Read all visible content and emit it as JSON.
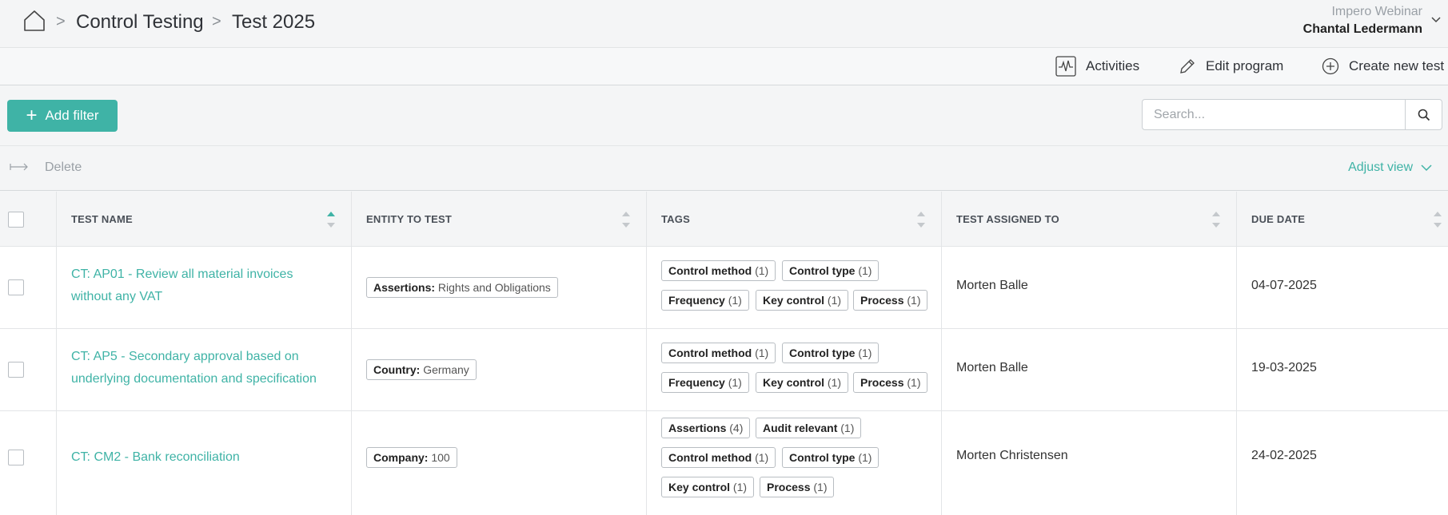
{
  "breadcrumb": {
    "items": [
      "Control Testing",
      "Test 2025"
    ],
    "separator": ">"
  },
  "user": {
    "company": "Impero Webinar",
    "name": "Chantal Ledermann"
  },
  "actions": {
    "activities": "Activities",
    "edit_program": "Edit program",
    "create_test": "Create new test"
  },
  "filter": {
    "add_label": "Add filter",
    "add_icon": "+",
    "search_placeholder": "Search..."
  },
  "bulk": {
    "delete": "Delete",
    "adjust_view": "Adjust view"
  },
  "columns": [
    "TEST NAME",
    "ENTITY TO TEST",
    "TAGS",
    "TEST ASSIGNED TO",
    "DUE DATE"
  ],
  "rows": [
    {
      "name_line1": "CT: AP01 - Review all material invoices",
      "name_line2": "without any VAT",
      "entity_key": "Assertions:",
      "entity_val": " Rights and Obligations",
      "tags": [
        {
          "k": "Control method",
          "c": " (1)"
        },
        {
          "k": "Control type",
          "c": " (1)"
        },
        {
          "k": "Frequency",
          "c": " (1)"
        },
        {
          "k": "Key control",
          "c": " (1)"
        },
        {
          "k": "Process",
          "c": " (1)"
        }
      ],
      "assigned": "Morten Balle",
      "due": "04-07-2025"
    },
    {
      "name_line1": "CT: AP5 - Secondary approval based on",
      "name_line2": "underlying documentation and specification",
      "entity_key": "Country:",
      "entity_val": " Germany",
      "tags": [
        {
          "k": "Control method",
          "c": " (1)"
        },
        {
          "k": "Control type",
          "c": " (1)"
        },
        {
          "k": "Frequency",
          "c": " (1)"
        },
        {
          "k": "Key control",
          "c": " (1)"
        },
        {
          "k": "Process",
          "c": " (1)"
        }
      ],
      "assigned": "Morten Balle",
      "due": "19-03-2025"
    },
    {
      "name_line1": "CT: CM2 - Bank reconciliation",
      "name_line2": "",
      "entity_key": "Company:",
      "entity_val": " 100",
      "tags": [
        {
          "k": "Assertions",
          "c": " (4)"
        },
        {
          "k": "Audit relevant",
          "c": " (1)"
        },
        {
          "k": "Control method",
          "c": " (1)"
        },
        {
          "k": "Control type",
          "c": " (1)"
        },
        {
          "k": "Key control",
          "c": " (1)"
        },
        {
          "k": "Process",
          "c": " (1)"
        }
      ],
      "assigned": "Morten Christensen",
      "due": "24-02-2025"
    }
  ],
  "colors": {
    "accent": "#3fb3a6",
    "text": "#333333",
    "muted": "#9aa0a6"
  }
}
